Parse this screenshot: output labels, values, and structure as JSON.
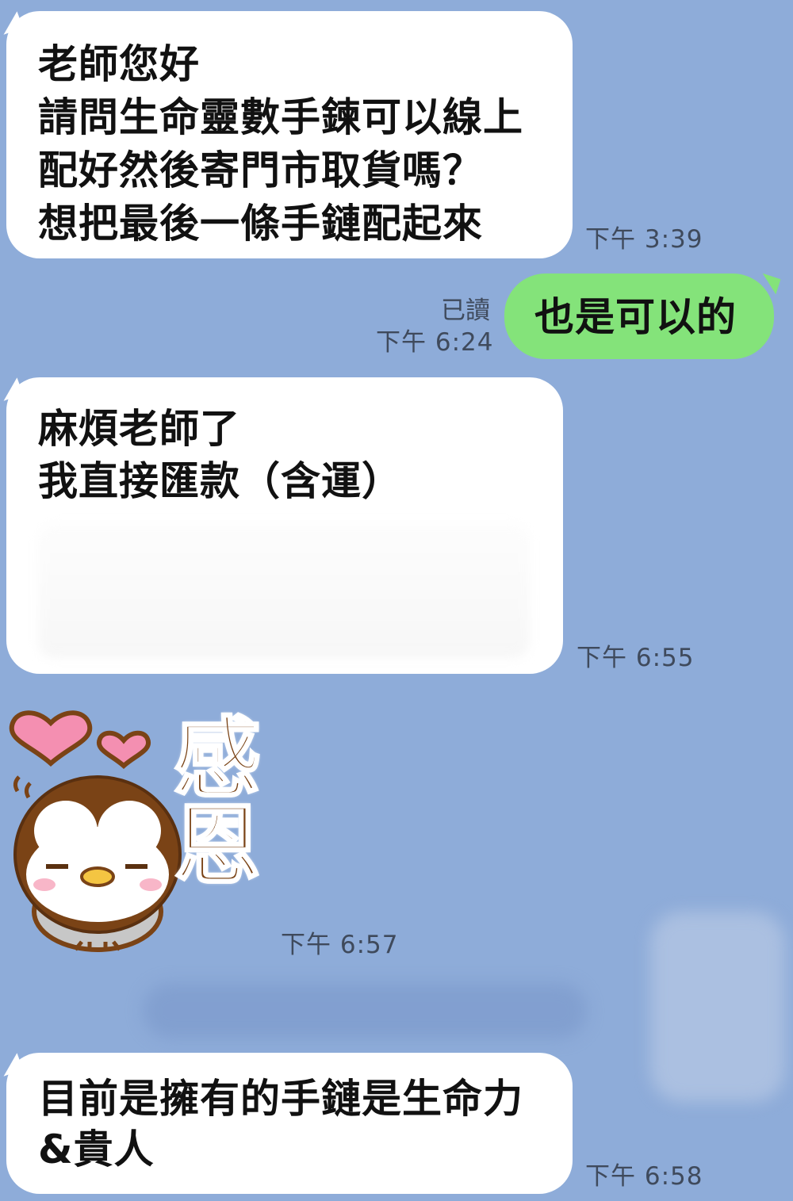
{
  "messages": [
    {
      "lines": [
        "老師您好",
        "請問生命靈數手鍊可以線上",
        "配好然後寄門市取貨嗎？",
        " 想把最後一條手鏈配起來"
      ],
      "time": "下午 3:39"
    },
    {
      "lines": [
        "也是可以的"
      ],
      "read": "已讀",
      "time": "下午 6:24"
    },
    {
      "lines": [
        "麻煩老師了",
        "我直接匯款（含運）"
      ],
      "time": "下午 6:55"
    },
    {
      "sticker_text": [
        "感",
        "恩"
      ],
      "time": "下午 6:57"
    },
    {
      "lines": [
        "目前是擁有的手鏈是生命力",
        "&貴人"
      ],
      "time": "下午 6:58"
    }
  ],
  "colors": {
    "background": "#8eacd9",
    "incoming_bubble": "#ffffff",
    "outgoing_bubble": "#84e37a",
    "heart": "#f48fb1",
    "penguin": "#7a4316"
  }
}
